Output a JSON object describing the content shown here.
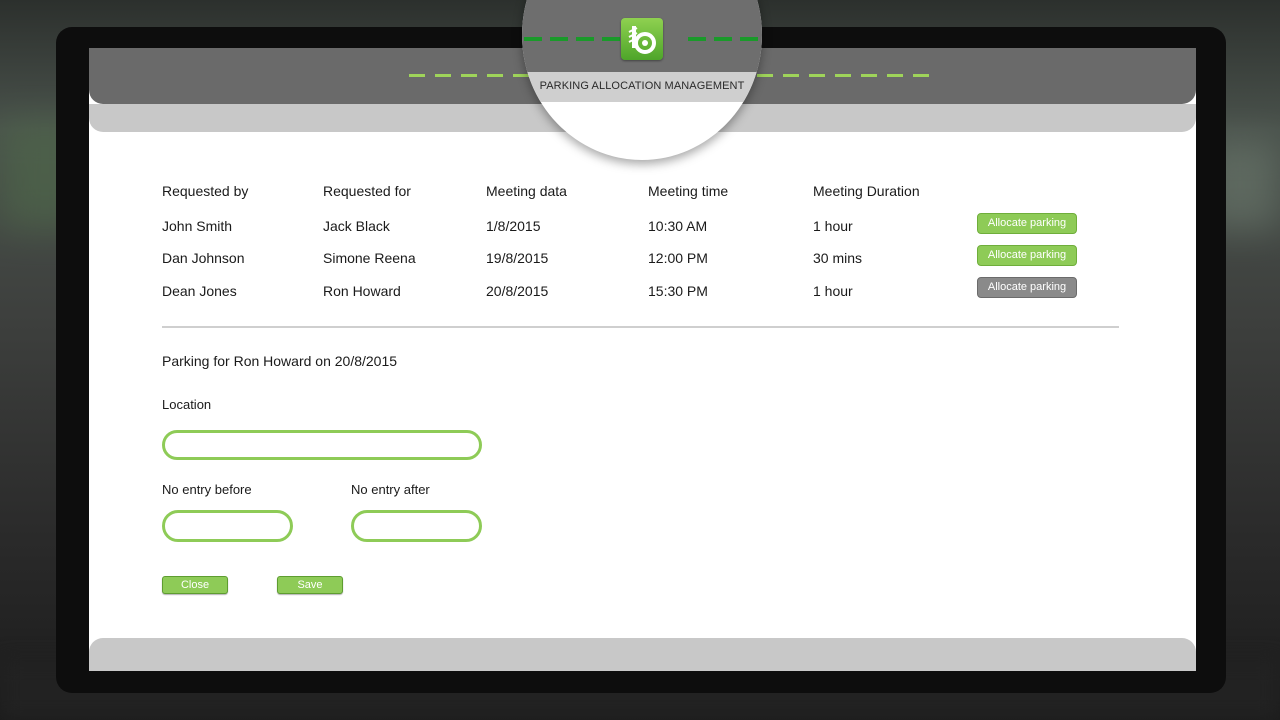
{
  "app": {
    "title": "PARKING ALLOCATION MANAGEMENT"
  },
  "table": {
    "headers": [
      "Requested by",
      "Requested for",
      "Meeting data",
      "Meeting time",
      "Meeting Duration"
    ],
    "rows": [
      {
        "requested_by": "John Smith",
        "requested_for": "Jack Black",
        "date": "1/8/2015",
        "time": "10:30 AM",
        "duration": "1 hour",
        "action": "Allocate parking",
        "action_state": "active"
      },
      {
        "requested_by": "Dan Johnson",
        "requested_for": "Simone Reena",
        "date": "19/8/2015",
        "time": "12:00 PM",
        "duration": "30 mins",
        "action": "Allocate parking",
        "action_state": "active"
      },
      {
        "requested_by": "Dean Jones",
        "requested_for": "Ron Howard",
        "date": "20/8/2015",
        "time": "15:30 PM",
        "duration": "1 hour",
        "action": "Allocate parking",
        "action_state": "selected"
      }
    ]
  },
  "form": {
    "title": "Parking for Ron Howard on 20/8/2015",
    "location_label": "Location",
    "location_value": "",
    "no_entry_before_label": "No entry before",
    "no_entry_before_value": "",
    "no_entry_after_label": "No entry after",
    "no_entry_after_value": "",
    "close_label": "Close",
    "save_label": "Save"
  },
  "colors": {
    "accent": "#8ecb57",
    "selected_button": "#8a8a8a",
    "header": "#6a6a6a"
  },
  "icons": {
    "logo": "parking-logo-icon"
  }
}
